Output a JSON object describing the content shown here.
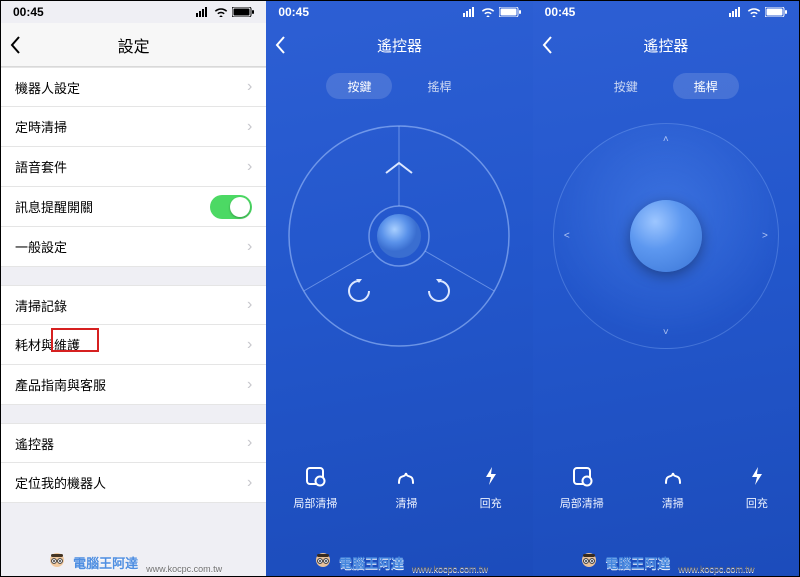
{
  "statusbar": {
    "time": "00:45"
  },
  "settings": {
    "title": "設定",
    "groups": {
      "g1": {
        "robot": {
          "label": "機器人設定"
        },
        "timer": {
          "label": "定時清掃"
        },
        "voice": {
          "label": "語音套件"
        },
        "notify": {
          "label": "訊息提醒開關"
        },
        "general": {
          "label": "一般設定"
        }
      },
      "g2": {
        "log": {
          "label": "清掃記錄"
        },
        "consume": {
          "label": "耗材與維護"
        },
        "support": {
          "label": "產品指南與客服"
        }
      },
      "g3": {
        "remote": {
          "label": "遙控器"
        },
        "locate": {
          "label": "定位我的機器人"
        }
      }
    }
  },
  "remote": {
    "title": "遙控器",
    "tabs": {
      "buttons": "按鍵",
      "joystick": "搖桿"
    },
    "actions": {
      "spot": "局部清掃",
      "clean": "清掃",
      "dock": "回充"
    }
  },
  "watermark": {
    "text": "電腦王阿達",
    "url": "www.kocpc.com.tw"
  }
}
